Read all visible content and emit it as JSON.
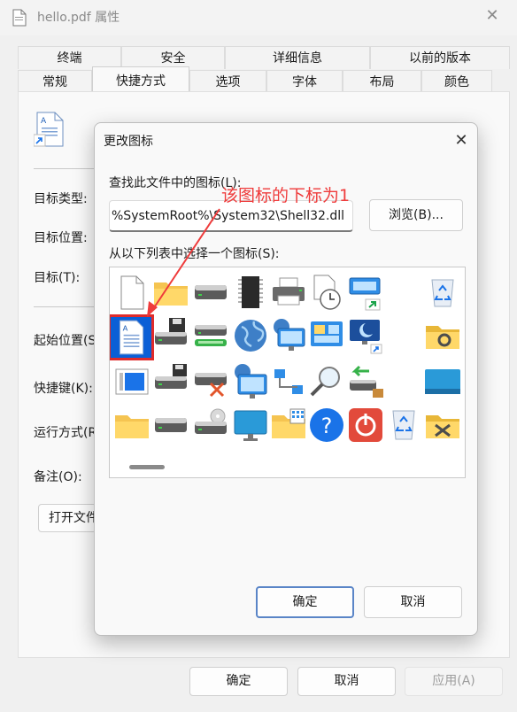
{
  "window": {
    "title": "hello.pdf 属性",
    "tabs_row1": [
      "终端",
      "安全",
      "详细信息",
      "以前的版本"
    ],
    "tabs_row2": [
      "常规",
      "快捷方式",
      "选项",
      "字体",
      "布局",
      "颜色"
    ],
    "active_tab": "快捷方式",
    "fields": {
      "target_type": "目标类型:",
      "target_location": "目标位置:",
      "target": "目标(T):",
      "start_in": "起始位置(S",
      "shortcut_key": "快捷键(K):",
      "run": "运行方式(R",
      "comment": "备注(O):"
    },
    "open_location_label": "打开文件位置(F)",
    "buttons": {
      "ok": "确定",
      "cancel": "取消",
      "apply": "应用(A)"
    }
  },
  "dialog": {
    "title": "更改图标",
    "find_label": "查找此文件中的图标(L):",
    "path_value": "%SystemRoot%\\System32\\Shell32.dll",
    "browse_label": "浏览(B)...",
    "list_label": "从以下列表中选择一个图标(S):",
    "ok_label": "确定",
    "cancel_label": "取消",
    "icons": [
      "blank-file-icon",
      "shortcut-document-icon",
      "folder-closed-icon",
      "hard-drive-icon",
      "drive-with-floppy-icon",
      "folder-open-icon",
      "drive-green-icon",
      "chip-icon",
      "hard-drive-icon",
      "drive-x-icon",
      "printer-icon",
      "globe-icon",
      "network-pc-icon",
      "drive-disc-icon",
      "clock-document-icon",
      "globe-monitor-icon",
      "network-drive-icon",
      "monitor-icon",
      "monitor-shortcut-icon",
      "control-panel-icon",
      "magnifier-icon",
      "folder-grid-icon",
      "recycle-bin-icon",
      "sleep-monitor-icon",
      "help-icon",
      "drive-export-icon",
      "power-icon",
      "folder-settings-icon",
      "monitor-blue-icon",
      "recycle-bin-empty-icon",
      "folder-tools-icon"
    ]
  },
  "annotation": {
    "text": "该图标的下标为1",
    "color": "#ef3b3b"
  },
  "colors": {
    "selection": "#0b5fd6",
    "highlight_border": "#e02b2b",
    "primary_border": "#5a85c7"
  }
}
